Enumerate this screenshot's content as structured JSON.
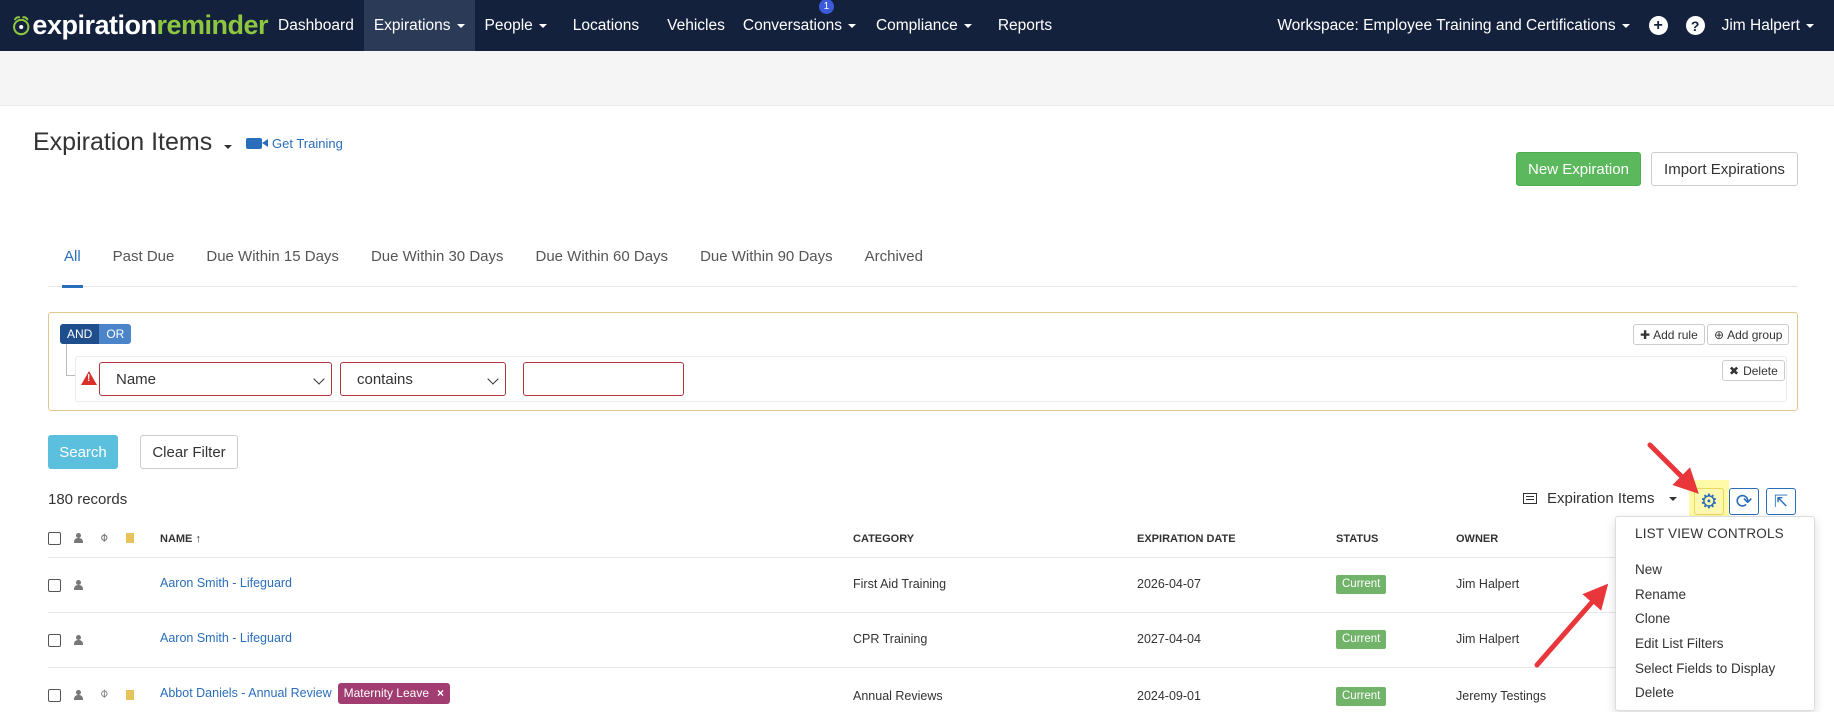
{
  "brand": {
    "part1": "expiration",
    "part2": "reminder"
  },
  "nav": {
    "items": [
      {
        "label": "Dashboard",
        "dropdown": false
      },
      {
        "label": "Expirations",
        "dropdown": true,
        "active": true
      },
      {
        "label": "People",
        "dropdown": true
      },
      {
        "label": "Locations",
        "dropdown": false
      },
      {
        "label": "Vehicles",
        "dropdown": false
      },
      {
        "label": "Conversations",
        "dropdown": true,
        "badge": "1"
      },
      {
        "label": "Compliance",
        "dropdown": true
      },
      {
        "label": "Reports",
        "dropdown": false
      }
    ],
    "workspace": "Workspace: Employee Training and Certifications",
    "plus_glyph": "+",
    "help_glyph": "?",
    "user": "Jim Halpert"
  },
  "header": {
    "title": "Expiration Items",
    "training": "Get Training",
    "new_button": "New Expiration",
    "import_button": "Import Expirations"
  },
  "tabs": [
    "All",
    "Past Due",
    "Due Within 15 Days",
    "Due Within 30 Days",
    "Due Within 60 Days",
    "Due Within 90 Days",
    "Archived"
  ],
  "filter": {
    "and": "AND",
    "or": "OR",
    "field": "Name",
    "operator": "contains",
    "value": "",
    "add_rule": "Add rule",
    "add_group": "Add group",
    "delete": "Delete"
  },
  "actions": {
    "search": "Search",
    "clear": "Clear Filter"
  },
  "records": "180 records",
  "view": {
    "label": "Expiration Items"
  },
  "table": {
    "headers": {
      "name": "NAME",
      "sort": "↑",
      "category": "CATEGORY",
      "date": "EXPIRATION DATE",
      "status": "STATUS",
      "owner": "OWNER"
    },
    "rows": [
      {
        "name": "Aaron Smith - Lifeguard",
        "category": "First Aid Training",
        "date": "2026-04-07",
        "status": "Current",
        "owner": "Jim Halpert",
        "tag": ""
      },
      {
        "name": "Aaron Smith - Lifeguard",
        "category": "CPR Training",
        "date": "2027-04-04",
        "status": "Current",
        "owner": "Jim Halpert",
        "tag": ""
      },
      {
        "name": "Abbot Daniels - Annual Review",
        "category": "Annual Reviews",
        "date": "2024-09-01",
        "status": "Current",
        "owner": "Jeremy Testings",
        "tag": "Maternity Leave"
      }
    ]
  },
  "menu": {
    "header": "LIST VIEW CONTROLS",
    "items": [
      "New",
      "Rename",
      "Clone",
      "Edit List Filters",
      "Select Fields to Display",
      "Delete"
    ]
  },
  "colors": {
    "navbar": "#14213d",
    "brand_green": "#8dc63f",
    "accent_blue": "#2a6ebb",
    "success": "#5cb85c",
    "info": "#5bc0de",
    "status_current": "#72b36a",
    "tag": "#a13d70",
    "arrow": "#e8363a"
  }
}
